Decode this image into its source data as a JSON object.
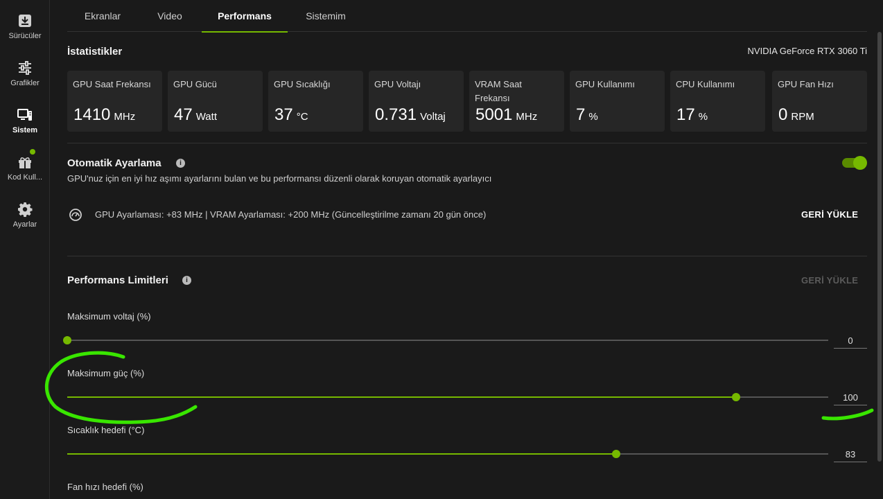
{
  "sidebar": {
    "items": [
      {
        "label": "Sürücüler",
        "icon": "download-icon"
      },
      {
        "label": "Grafikler",
        "icon": "sliders-icon"
      },
      {
        "label": "Sistem",
        "icon": "monitor-icon",
        "active": true
      },
      {
        "label": "Kod Kull...",
        "icon": "gift-icon",
        "badge": true
      },
      {
        "label": "Ayarlar",
        "icon": "gear-icon"
      }
    ]
  },
  "tabs": [
    {
      "label": "Ekranlar"
    },
    {
      "label": "Video"
    },
    {
      "label": "Performans",
      "active": true
    },
    {
      "label": "Sistemim"
    }
  ],
  "stats": {
    "title": "İstatistikler",
    "gpu_name": "NVIDIA GeForce RTX 3060 Ti",
    "cards": [
      {
        "name": "GPU Saat Frekansı",
        "value": "1410",
        "unit": "MHz"
      },
      {
        "name": "GPU Gücü",
        "value": "47",
        "unit": "Watt"
      },
      {
        "name": "GPU Sıcaklığı",
        "value": "37",
        "unit": "°C"
      },
      {
        "name": "GPU Voltajı",
        "value": "0.731",
        "unit": "Voltaj"
      },
      {
        "name": "VRAM Saat Frekansı",
        "value": "5001",
        "unit": "MHz"
      },
      {
        "name": "GPU Kullanımı",
        "value": "7",
        "unit": "%"
      },
      {
        "name": "CPU Kullanımı",
        "value": "17",
        "unit": "%"
      },
      {
        "name": "GPU Fan Hızı",
        "value": "0",
        "unit": "RPM"
      }
    ]
  },
  "auto_tune": {
    "title": "Otomatik Ayarlama",
    "description": "GPU'nuz için en iyi hız aşımı ayarlarını bulan ve bu performansı düzenli olarak koruyan otomatik ayarlayıcı",
    "enabled": true,
    "status": "GPU Ayarlaması: +83 MHz   |  VRAM Ayarlaması: +200 MHz (Güncelleştirilme zamanı 20 gün önce)",
    "reset_label": "GERİ YÜKLE"
  },
  "limits": {
    "title": "Performans Limitleri",
    "reset_label": "GERİ YÜKLE",
    "reset_enabled": false,
    "sliders": [
      {
        "label": "Maksimum voltaj (%)",
        "value": "0",
        "fraction": 0.0
      },
      {
        "label": "Maksimum güç (%)",
        "value": "100",
        "fraction": 0.879
      },
      {
        "label": "Sıcaklık hedefi (°C)",
        "value": "83",
        "fraction": 0.721
      },
      {
        "label": "Fan hızı hedefi (%)"
      }
    ]
  },
  "colors": {
    "accent": "#76b900",
    "background": "#1a1a1a",
    "card": "#262626",
    "annotation": "#39e600"
  }
}
